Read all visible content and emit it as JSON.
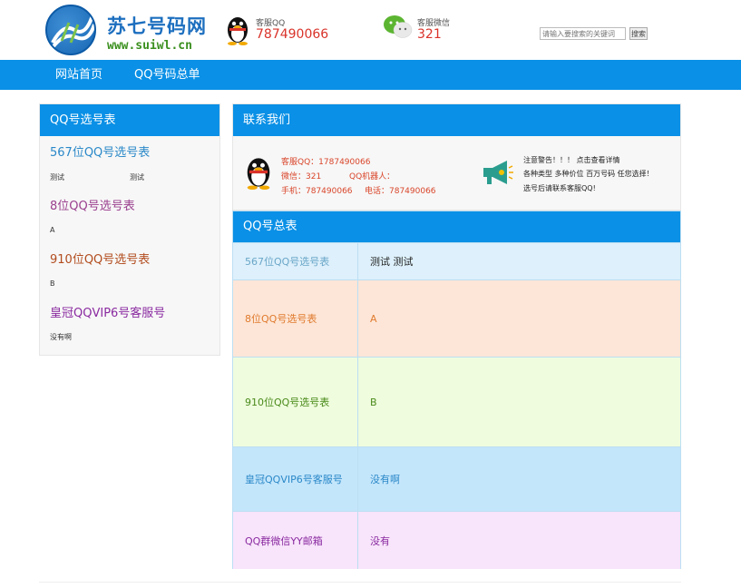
{
  "header": {
    "site_title": "苏七号码网",
    "site_url": "www.suiwl.cn",
    "qq_label": "客服QQ",
    "qq_number": "787490066",
    "wechat_label": "客服微信",
    "wechat_number": "321",
    "search_placeholder": "请输入要搜索的关键词",
    "search_button": "搜索"
  },
  "nav": {
    "items": [
      {
        "label": "网站首页"
      },
      {
        "label": "QQ号码总单"
      }
    ]
  },
  "left_panel": {
    "title": "QQ号选号表",
    "sections": [
      {
        "title": "567位QQ号选号表",
        "subs": [
          "测试",
          "测试"
        ],
        "color": "#2a88c8"
      },
      {
        "title": "8位QQ号选号表",
        "subs": [
          "A"
        ],
        "color": "#9a3f8e"
      },
      {
        "title": "910位QQ号选号表",
        "subs": [
          "B"
        ],
        "color": "#b24c1e"
      },
      {
        "title": "皇冠QQVIP6号客服号",
        "subs": [
          "没有啊"
        ],
        "color": "#8a2aa0"
      }
    ]
  },
  "contact_panel": {
    "title": "联系我们",
    "qq_line": "客服QQ：1787490066",
    "wechat_line": "微信：321",
    "robot_line": "QQ机器人：",
    "phone_line": "手机：787490066",
    "tel_line": "电话：787490066",
    "notice": [
      "注意警告！！！  点击查看详情",
      "各种类型 多种价位 百万号码 任您选择！",
      "选号后请联系客服QQ!"
    ]
  },
  "summary_panel": {
    "title": "QQ号总表",
    "rows": [
      {
        "name": "567位QQ号选号表",
        "value": "测试      测试",
        "bg": "#ddf0fb",
        "name_color": "#6aa6c8",
        "value_color": "#222"
      },
      {
        "name": "8位QQ号选号表",
        "value": "A",
        "bg": "#fde6d7",
        "name_color": "#e07a2e",
        "value_color": "#e07a2e"
      },
      {
        "name": "910位QQ号选号表",
        "value": "B",
        "bg": "#effcde",
        "name_color": "#4a8a1a",
        "value_color": "#4a8a1a"
      },
      {
        "name": "皇冠QQVIP6号客服号",
        "value": "没有啊",
        "bg": "#c4e6fb",
        "name_color": "#2a88c8",
        "value_color": "#2a88c8"
      },
      {
        "name": "QQ群微信YY邮箱",
        "value": "没有",
        "bg": "#f8e4fb",
        "name_color": "#8a2aa0",
        "value_color": "#8a2aa0"
      }
    ]
  },
  "colors": {
    "accent": "#0a90e6",
    "hotline": "#d9332a"
  }
}
